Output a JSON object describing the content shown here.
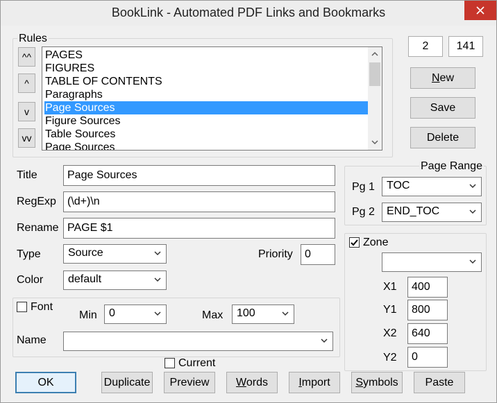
{
  "window": {
    "title": "BookLink - Automated PDF Links and Bookmarks",
    "close": "✕"
  },
  "rules": {
    "label": "Rules",
    "move_buttons": [
      "^^",
      "^",
      "v",
      "vv"
    ],
    "items": [
      "PAGES",
      "FIGURES",
      "TABLE OF CONTENTS",
      "Paragraphs",
      "Page Sources",
      "Figure Sources",
      "Table Sources",
      "Page Sources"
    ],
    "selected_index": 4
  },
  "counters": {
    "current": "2",
    "total": "141"
  },
  "side_buttons": {
    "new_mnemonic": "N",
    "new_rest": "ew",
    "save": "Save",
    "delete": "Delete"
  },
  "form": {
    "title_label": "Title",
    "title_value": "Page Sources",
    "regexp_label": "RegExp",
    "regexp_value": "(\\d+)\\n",
    "rename_label": "Rename",
    "rename_value": "PAGE $1",
    "type_label": "Type",
    "type_value": "Source",
    "priority_label": "Priority",
    "priority_value": "0",
    "color_label": "Color",
    "color_value": "default"
  },
  "font_group": {
    "font_label": "Font",
    "font_checked": false,
    "min_label": "Min",
    "min_value": "0",
    "max_label": "Max",
    "max_value": "100",
    "name_label": "Name",
    "name_value": ""
  },
  "page_range": {
    "label": "Page Range",
    "pg1_label": "Pg 1",
    "pg1_value": "TOC",
    "pg2_label": "Pg 2",
    "pg2_value": "END_TOC"
  },
  "zone": {
    "label": "Zone",
    "checked": true,
    "dropdown_value": "",
    "x1_label": "X1",
    "x1_value": "400",
    "y1_label": "Y1",
    "y1_value": "800",
    "x2_label": "X2",
    "x2_value": "640",
    "y2_label": "Y2",
    "y2_value": "0"
  },
  "current_check": {
    "label": "Current",
    "checked": false
  },
  "bottom_buttons": {
    "ok": "OK",
    "duplicate": "Duplicate",
    "preview": "Preview",
    "words_mnemonic": "W",
    "words_rest": "ords",
    "import_mnemonic": "I",
    "import_rest": "mport",
    "symbols_mnemonic": "S",
    "symbols_rest": "ymbols",
    "paste": "Paste"
  },
  "colors": {
    "selection": "#3399ff",
    "close": "#c7352b",
    "default_border": "#3c7fb1"
  }
}
